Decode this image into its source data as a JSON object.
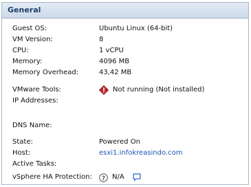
{
  "panel": {
    "title": "General"
  },
  "rows": [
    {
      "label": "Guest OS:",
      "value": "Ubuntu Linux (64-bit)"
    },
    {
      "label": "VM Version:",
      "value": "8"
    },
    {
      "label": "CPU:",
      "value": "1 vCPU"
    },
    {
      "label": "Memory:",
      "value": "4096 MB"
    },
    {
      "label": "Memory Overhead:",
      "value": "43,42 MB"
    },
    {
      "label": "VMware Tools:",
      "value": "Not running (Not installed)",
      "icon": "warning-icon"
    },
    {
      "label": "IP Addresses:",
      "value": ""
    },
    {
      "label": "DNS Name:",
      "value": ""
    },
    {
      "label": "State:",
      "value": "Powered On"
    },
    {
      "label": "Host:",
      "value": "esxi1.infokreasindo.com"
    },
    {
      "label": "Active Tasks:",
      "value": ""
    },
    {
      "label": "vSphere HA Protection:",
      "value": "N/A",
      "icon": "help-icon",
      "trailing_icon": "comment-icon"
    }
  ],
  "colors": {
    "header_text": "#1f3d6b",
    "link": "#1a55b5",
    "warning": "#c0282d"
  }
}
